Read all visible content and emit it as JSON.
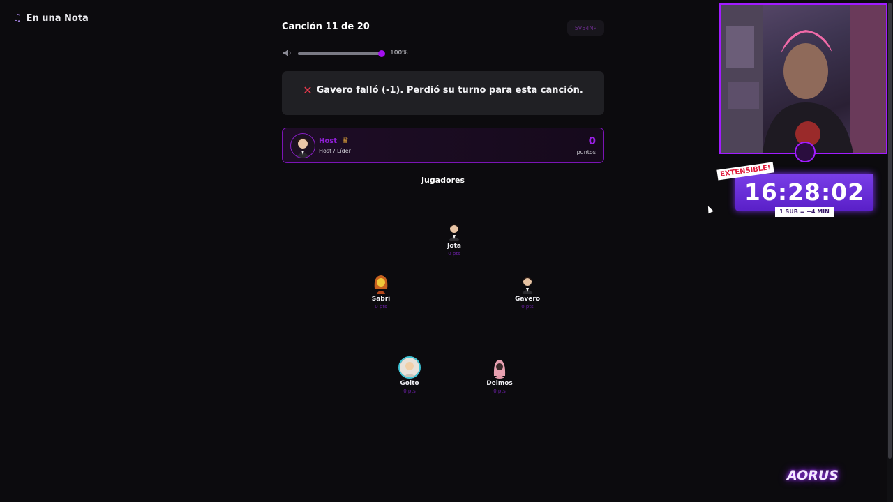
{
  "app": {
    "name": "En una Nota",
    "icon": "music-note-icon"
  },
  "song": {
    "title": "Canción 11 de 20",
    "room_code": "5V54NP"
  },
  "volume": {
    "label": "100%",
    "level": 1.0
  },
  "message": {
    "icon": "cross-mark-icon",
    "text": "Gavero falló (-1). Perdió su turno para esta canción."
  },
  "host": {
    "name": "Host",
    "role": "Host / Líder",
    "points": "0",
    "points_label": "puntos",
    "badge_icon": "crown-icon"
  },
  "players_title": "Jugadores",
  "players": [
    {
      "name": "Jota",
      "points": "0 pts"
    },
    {
      "name": "Sabri",
      "points": "0 pts"
    },
    {
      "name": "Gavero",
      "points": "0 pts"
    },
    {
      "name": "Goito",
      "points": "0 pts"
    },
    {
      "name": "Deimos",
      "points": "0 pts"
    }
  ],
  "overlay": {
    "timer": "16:28:02",
    "extensible": "EXTENSIBLE!",
    "sub_rule": "1 SUB = +4 MIN",
    "logo": "AORUS"
  },
  "colors": {
    "background": "#0c0b0e",
    "accent": "#a40ff0",
    "error": "#e5394c",
    "card": "#202024"
  }
}
